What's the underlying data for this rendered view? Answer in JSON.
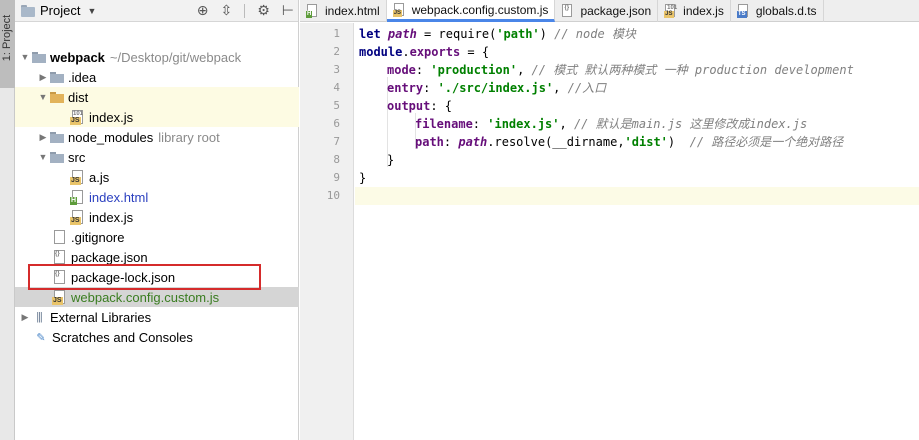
{
  "tool_strip": {
    "label": "1: Project"
  },
  "project_panel": {
    "title": "Project",
    "tree": [
      {
        "label": "webpack",
        "suffix": "~/Desktop/git/webpack"
      },
      {
        "label": ".idea"
      },
      {
        "label": "dist"
      },
      {
        "label": "index.js"
      },
      {
        "label": "node_modules",
        "suffix": "library root"
      },
      {
        "label": "src"
      },
      {
        "label": "a.js"
      },
      {
        "label": "index.html"
      },
      {
        "label": "index.js"
      },
      {
        "label": ".gitignore"
      },
      {
        "label": "package.json"
      },
      {
        "label": "package-lock.json"
      },
      {
        "label": "webpack.config.custom.js"
      },
      {
        "label": "External Libraries"
      },
      {
        "label": "Scratches and Consoles"
      }
    ]
  },
  "editor": {
    "tabs": [
      {
        "label": "index.html"
      },
      {
        "label": "webpack.config.custom.js"
      },
      {
        "label": "package.json"
      },
      {
        "label": "index.js"
      },
      {
        "label": "globals.d.ts"
      }
    ],
    "line_numbers": [
      "1",
      "2",
      "3",
      "4",
      "5",
      "6",
      "7",
      "8",
      "9",
      "10"
    ],
    "code": {
      "l1": {
        "kw": "let",
        "var": "path",
        "eq": " = ",
        "fn": "require(",
        "str": "'path'",
        "close": ")",
        "cm": " // node 模块"
      },
      "l2": {
        "obj": "module",
        "dot": ".",
        "prop": "exports",
        "rest": " = {"
      },
      "l3": {
        "key": "mode",
        "colon": ": ",
        "str": "'production'",
        "comma": ", ",
        "cm": "// 模式 默认两种模式 一种 production development"
      },
      "l4": {
        "key": "entry",
        "colon": ": ",
        "str": "'./src/index.js'",
        "comma": ", ",
        "cm": "//入口"
      },
      "l5": {
        "key": "output",
        "rest": ": {"
      },
      "l6": {
        "key": "filename",
        "colon": ": ",
        "str": "'index.js'",
        "comma": ", ",
        "cm": "// 默认是main.js 这里修改成index.js"
      },
      "l7": {
        "key": "path",
        "colon": ": ",
        "var": "path",
        "dot": ".",
        "fn": "resolve(__dirname,",
        "str": "'dist'",
        "close": ")",
        "cm": "  // 路径必须是一个绝对路径"
      },
      "l8": {
        "rest": "}"
      },
      "l9": {
        "rest": "}"
      }
    }
  }
}
